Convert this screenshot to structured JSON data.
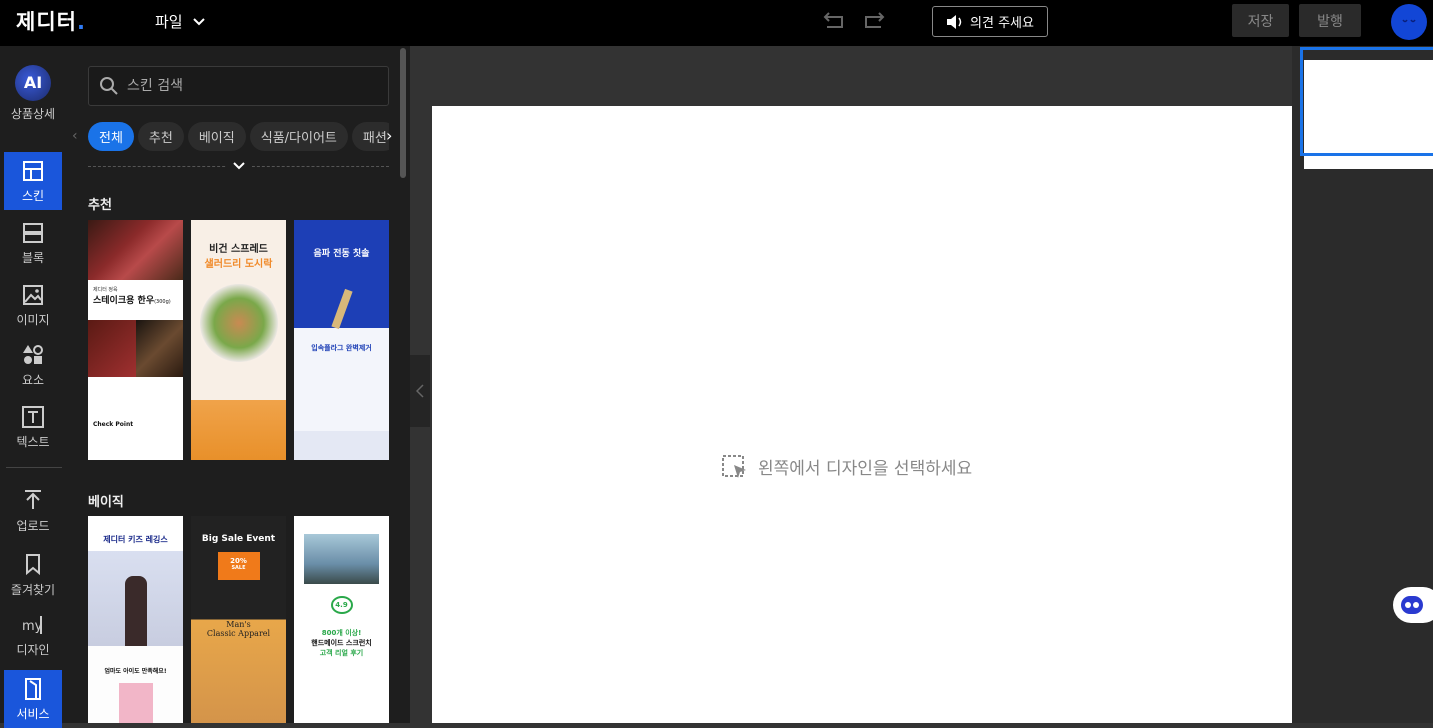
{
  "header": {
    "logo": "제디터",
    "logo_dot": ".",
    "file_menu": "파일",
    "feedback": "의견 주세요",
    "save": "저장",
    "publish": "발행"
  },
  "nav": {
    "ai_label": "AI",
    "ai_caption": "상품상세",
    "skin": "스킨",
    "block": "블록",
    "image": "이미지",
    "element": "요소",
    "text": "텍스트",
    "upload": "업로드",
    "favorites": "즐겨찾기",
    "my_design": "디자인",
    "service": "서비스"
  },
  "panel": {
    "search_placeholder": "스킨 검색",
    "chips": [
      "전체",
      "추천",
      "베이직",
      "식품/다이어트",
      "패션"
    ],
    "section_recommended": "추천",
    "section_basic": "베이직",
    "thumbs": {
      "t1_brand": "제디터 정육",
      "t1_title": "스테이크용 한우",
      "t1_weight": "(300g)",
      "t1_foot": "Check Point",
      "t2_title": "비건 스프레드",
      "t2_sub": "샐러드리 도시락",
      "t3_title": "음파 전동 칫솔",
      "t3_sub": "입속플라그 완벽제거",
      "t4_title": "제디터 키즈 레깅스",
      "t4_sub": "엄마도 아이도 만족해요!",
      "t5_title": "Big Sale Event",
      "t5_badge": "20%",
      "t5_sale": "SALE",
      "t5_sub1": "Man's",
      "t5_sub2": "Classic Apparel",
      "t6_score": "4.9",
      "t6_line1": "800개 이상!",
      "t6_line2": "핸드메이드 스크런치",
      "t6_line3": "고객 리얼 후기"
    }
  },
  "canvas": {
    "empty_message": "왼쪽에서 디자인을 선택하세요"
  },
  "colors": {
    "accent": "#1a73e8",
    "nav_active": "#1a56db"
  }
}
